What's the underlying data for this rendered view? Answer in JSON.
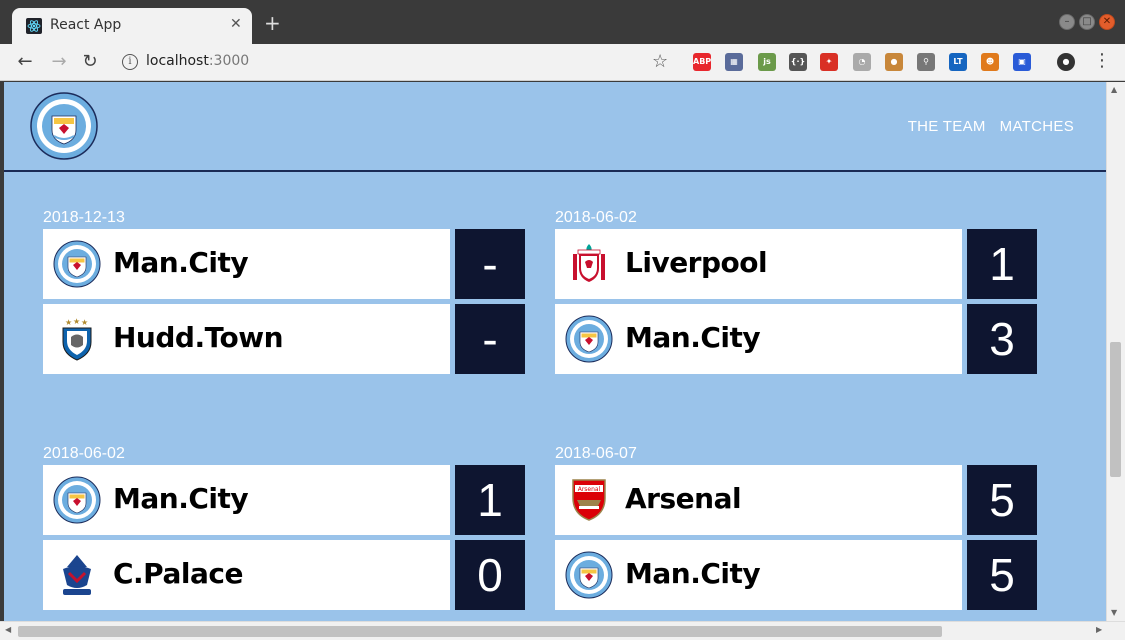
{
  "browser": {
    "tab_title": "React App",
    "tab_close": "✕",
    "new_tab": "+",
    "url_host": "localhost",
    "url_port": ":3000",
    "extensions": [
      {
        "name": "adblock-icon",
        "label": "ABP",
        "color": "#e8272d"
      },
      {
        "name": "extension-grid-icon",
        "label": "▦",
        "color": "#5a6b9a"
      },
      {
        "name": "js-icon",
        "label": "js",
        "color": "#6b9a4a"
      },
      {
        "name": "json-icon",
        "label": "{·}",
        "color": "#555555"
      },
      {
        "name": "extension-red-icon",
        "label": "✦",
        "color": "#d93025"
      },
      {
        "name": "timer-icon",
        "label": "◔",
        "color": "#aaaaaa"
      },
      {
        "name": "cookie-icon",
        "label": "●",
        "color": "#c8873a"
      },
      {
        "name": "bike-icon",
        "label": "⚲",
        "color": "#777777"
      },
      {
        "name": "lt-icon",
        "label": "LT",
        "color": "#1565c0"
      },
      {
        "name": "tiger-icon",
        "label": "☻",
        "color": "#e07a1c"
      },
      {
        "name": "save-icon",
        "label": "▣",
        "color": "#2a5bd7"
      },
      {
        "name": "profile-avatar-icon",
        "label": "●",
        "color": "#333333"
      }
    ]
  },
  "app": {
    "nav": [
      {
        "label": "THE TEAM"
      },
      {
        "label": "MATCHES"
      }
    ],
    "matches": [
      {
        "date": "2018-12-13",
        "home": {
          "name": "Man.City",
          "score": "-",
          "logo": "man-city"
        },
        "away": {
          "name": "Hudd.Town",
          "score": "-",
          "logo": "huddersfield"
        }
      },
      {
        "date": "2018-06-02",
        "home": {
          "name": "Liverpool",
          "score": "1",
          "logo": "liverpool"
        },
        "away": {
          "name": "Man.City",
          "score": "3",
          "logo": "man-city"
        }
      },
      {
        "date": "2018-06-02",
        "home": {
          "name": "Man.City",
          "score": "1",
          "logo": "man-city"
        },
        "away": {
          "name": "C.Palace",
          "score": "0",
          "logo": "crystal-palace"
        }
      },
      {
        "date": "2018-06-07",
        "home": {
          "name": "Arsenal",
          "score": "5",
          "logo": "arsenal"
        },
        "away": {
          "name": "Man.City",
          "score": "5",
          "logo": "man-city"
        }
      }
    ]
  }
}
